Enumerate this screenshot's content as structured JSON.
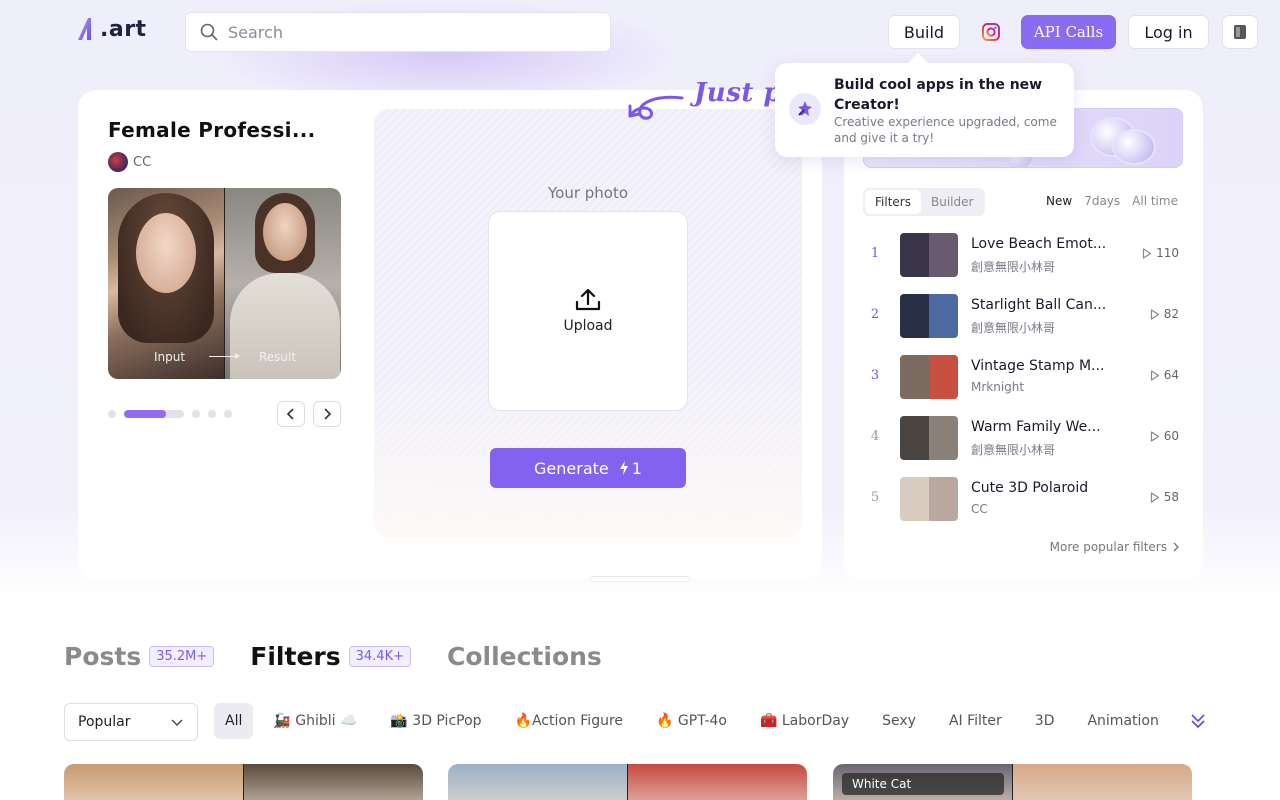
{
  "header": {
    "logo_text": ".art",
    "search_placeholder": "Search",
    "build_label": "Build",
    "api_label": "API Calls",
    "login_label": "Log in"
  },
  "tooltip": {
    "title": "Build cool apps in the new Creator!",
    "description": "Creative experience upgraded, come and give it a try!"
  },
  "featured": {
    "title": "Female Professi...",
    "author": "CC",
    "input_label": "Input",
    "result_label": "Result",
    "slide_progress": 0.7,
    "your_photo_label": "Your photo",
    "upload_label": "Upload",
    "generate_label": "Generate",
    "generate_cost": "1",
    "handwriting_text": "Just pl"
  },
  "ranking": {
    "tabs": [
      "Filters",
      "Builder"
    ],
    "active_tab": "Filters",
    "time_tabs": [
      "New",
      "7days",
      "All time"
    ],
    "active_time": "New",
    "items": [
      {
        "rank": "1",
        "title": "Love Beach Emot...",
        "author": "創意無限小林哥",
        "plays": "110",
        "colors": [
          "#3a3448",
          "#6a5a70"
        ]
      },
      {
        "rank": "2",
        "title": "Starlight Ball Can...",
        "author": "創意無限小林哥",
        "plays": "82",
        "colors": [
          "#2a2f48",
          "#4a6aa0"
        ]
      },
      {
        "rank": "3",
        "title": "Vintage Stamp M...",
        "author": "Mrknight",
        "plays": "64",
        "colors": [
          "#7a6a60",
          "#c85040"
        ]
      },
      {
        "rank": "4",
        "title": "Warm Family We...",
        "author": "創意無限小林哥",
        "plays": "60",
        "colors": [
          "#4a4440",
          "#8a8078"
        ]
      },
      {
        "rank": "5",
        "title": "Cute 3D Polaroid",
        "author": "CC",
        "plays": "58",
        "colors": [
          "#d8ccc0",
          "#b8a8a0"
        ]
      }
    ],
    "more_label": "More popular filters"
  },
  "sections": {
    "tabs": [
      {
        "label": "Posts",
        "count": "35.2M+"
      },
      {
        "label": "Filters",
        "count": "34.4K+"
      },
      {
        "label": "Collections",
        "count": ""
      }
    ],
    "active": "Filters"
  },
  "filters_bar": {
    "sort_value": "Popular",
    "categories": [
      "All",
      "🚂 Ghibli ☁️",
      "📸 3D PicPop",
      "🔥Action Figure",
      "🔥 GPT-4o",
      "🧰 LaborDay",
      "Sexy",
      "AI Filter",
      "3D",
      "Animation"
    ],
    "active_category": "All"
  },
  "cards": [
    {
      "tag": "",
      "colors": [
        "#c89a70",
        "#5a4a3a"
      ]
    },
    {
      "tag": "",
      "colors": [
        "#9ab0c8",
        "#c84a40"
      ]
    },
    {
      "tag": "White Cat",
      "colors": [
        "#6a6470",
        "#d8a888"
      ]
    }
  ],
  "colors": {
    "accent": "#8461ee",
    "accent_light": "#f2eefe"
  }
}
